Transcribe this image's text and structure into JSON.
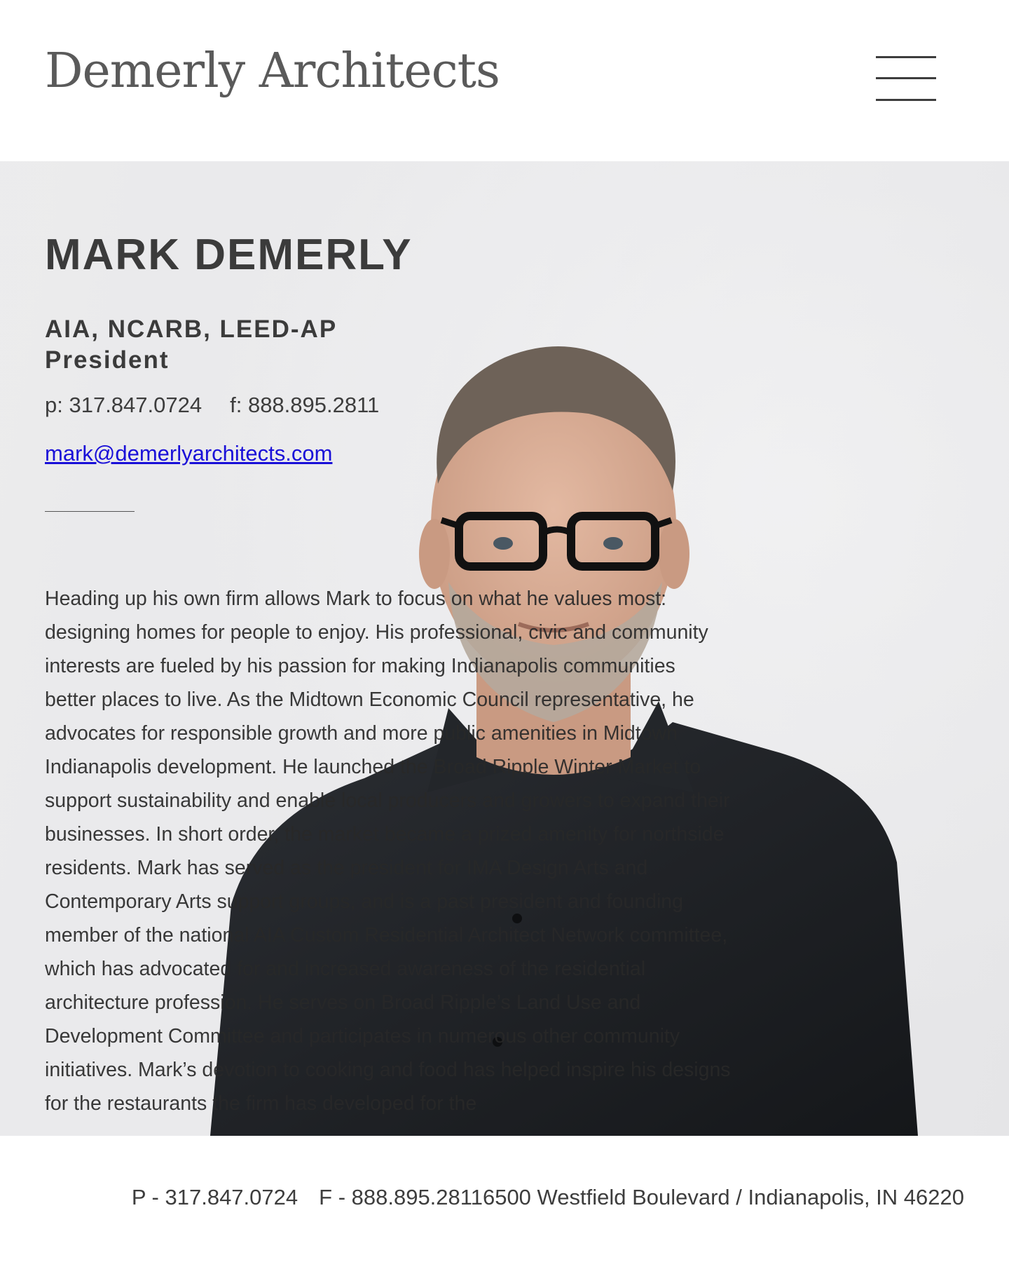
{
  "header": {
    "logo_text": "Demerly Architects",
    "menu_icon": "hamburger-menu-icon"
  },
  "profile": {
    "name": "MARK DEMERLY",
    "credentials": "AIA, NCARB, LEED-AP",
    "title": "President",
    "phone": "p: 317.847.0724",
    "fax": "f: 888.895.2811",
    "email": "mark@demerlyarchitects.com",
    "bio": "Heading up his own firm allows Mark to focus on what he values most: designing homes for people to enjoy. His professional, civic and community interests are fueled by his passion for making Indianapolis communities better places to live. As the Midtown Economic Council representative, he advocates for responsible growth and more public amenities in Midtown Indianapolis development. He launched the Broad Ripple Winter Market to support sustainability and enable local producers and growers to expand their businesses. In short order, the market became a prized amenity for northside residents. Mark has served as the president for IMA Design Arts and Contemporary Arts support groups, and is a past president and founding member of the national AIA Custom Residential Architect Network committee, which has advocated for and increased awareness of the residential architecture profession. He serves on Broad Ripple’s Land Use and Development Committee and participates in numerous other community initiatives. Mark’s devotion to cooking and food has helped inspire his designs for the restaurants the firm has developed for the"
  },
  "footer": {
    "phone": "P - 317.847.0724",
    "fax_address": "F - 888.895.28116500 Westfield Boulevard / Indianapolis, IN 46220"
  },
  "colors": {
    "text": "#3d3d3d",
    "link": "#1a10d8",
    "background": "#ffffff",
    "hero_background": "#ececee"
  }
}
